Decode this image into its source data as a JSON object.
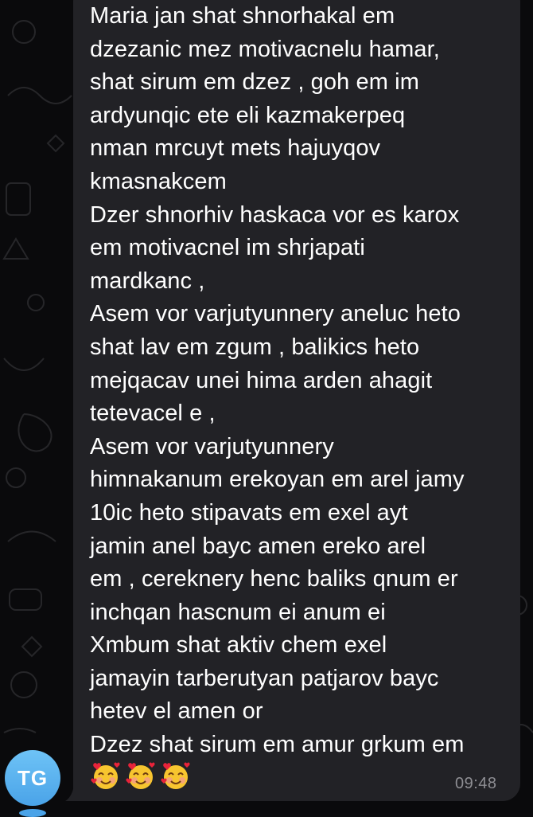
{
  "message": {
    "lines": [
      "Maria jan shat shnorhakal em",
      "dzezanic mez motivacnelu hamar,",
      "shat sirum em dzez , goh em im",
      "ardyunqic ete eli kazmakerpeq",
      "nman mrcuyt mets hajuyqov",
      "kmasnakcem",
      "Dzer shnorhiv haskaca vor es karox",
      "em motivacnel im shrjapati",
      "mardkanc ,",
      "Asem vor varjutyunnery aneluc heto",
      "shat lav em zgum , balikics heto",
      "mejqacav unei hima arden ahagit",
      "tetevacel e ,",
      "Asem vor varjutyunnery",
      "himnakanum erekoyan em arel jamy",
      "10ic heto stipavats em exel ayt",
      "jamin anel bayc amen ereko arel",
      "em , cereknery henc baliks qnum er",
      "inchqan hascnum ei anum ei",
      "Xmbum shat aktiv chem exel",
      "jamayin tarberutyan patjarov bayc",
      "hetev el amen or",
      "Dzez shat sirum em amur grkum em"
    ],
    "emojis": [
      "smiling-face-with-hearts-icon",
      "smiling-face-with-hearts-icon",
      "smiling-face-with-hearts-icon"
    ],
    "time": "09:48"
  },
  "sender": {
    "initials": "TG",
    "avatar_color": "#5bb4f0"
  },
  "colors": {
    "bubble": "#222226",
    "background": "#0a0a0c",
    "text": "#ffffff",
    "timestamp": "#8e8e93"
  }
}
